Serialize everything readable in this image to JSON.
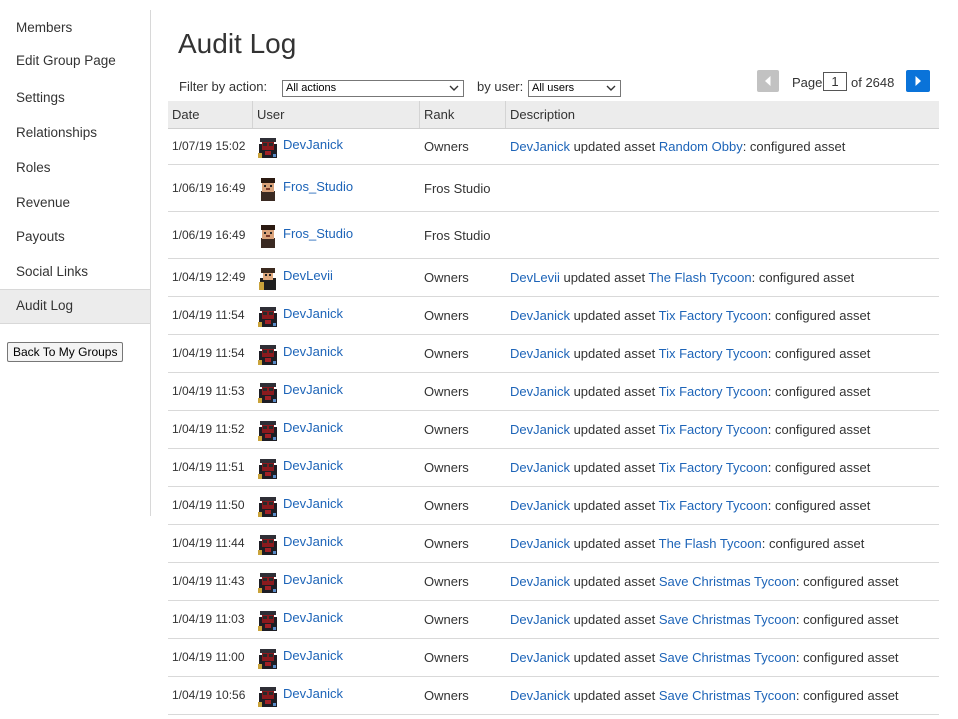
{
  "sidebar": {
    "items": [
      {
        "label": "Members"
      },
      {
        "label": "Edit Group Page"
      },
      {
        "label": "Settings"
      },
      {
        "label": "Relationships"
      },
      {
        "label": "Roles"
      },
      {
        "label": "Revenue"
      },
      {
        "label": "Payouts"
      },
      {
        "label": "Social Links"
      },
      {
        "label": "Audit Log",
        "active": true
      }
    ],
    "back_button": "Back To My Groups"
  },
  "main": {
    "title": "Audit Log",
    "filter_action_label": "Filter by action:",
    "filter_action_value": "All actions",
    "filter_user_label": "by user:",
    "filter_user_value": "All users"
  },
  "pagination": {
    "page_label": "Page",
    "current_page": "1",
    "of_label": "of 2648"
  },
  "table": {
    "headers": {
      "date": "Date",
      "user": "User",
      "rank": "Rank",
      "description": "Description"
    },
    "rows": [
      {
        "date": "1/07/19 15:02",
        "user": "DevJanick",
        "avatar": "devjanick",
        "rank": "Owners",
        "desc_user": "DevJanick",
        "desc_action": " updated asset ",
        "asset": "Random Obby",
        "desc_tail": ": configured asset"
      },
      {
        "date": "1/06/19 16:49",
        "user": "Fros_Studio",
        "avatar": "fros",
        "rank": "Fros Studio",
        "desc_user": "",
        "desc_action": "",
        "asset": "",
        "desc_tail": ""
      },
      {
        "date": "1/06/19 16:49",
        "user": "Fros_Studio",
        "avatar": "fros",
        "rank": "Fros Studio",
        "desc_user": "",
        "desc_action": "",
        "asset": "",
        "desc_tail": ""
      },
      {
        "date": "1/04/19 12:49",
        "user": "DevLevii",
        "avatar": "devlevii",
        "rank": "Owners",
        "desc_user": "DevLevii",
        "desc_action": " updated asset ",
        "asset": "The Flash Tycoon",
        "desc_tail": ": configured asset"
      },
      {
        "date": "1/04/19 11:54",
        "user": "DevJanick",
        "avatar": "devjanick",
        "rank": "Owners",
        "desc_user": "DevJanick",
        "desc_action": " updated asset ",
        "asset": "Tix Factory Tycoon",
        "desc_tail": ": configured asset"
      },
      {
        "date": "1/04/19 11:54",
        "user": "DevJanick",
        "avatar": "devjanick",
        "rank": "Owners",
        "desc_user": "DevJanick",
        "desc_action": " updated asset ",
        "asset": "Tix Factory Tycoon",
        "desc_tail": ": configured asset"
      },
      {
        "date": "1/04/19 11:53",
        "user": "DevJanick",
        "avatar": "devjanick",
        "rank": "Owners",
        "desc_user": "DevJanick",
        "desc_action": " updated asset ",
        "asset": "Tix Factory Tycoon",
        "desc_tail": ": configured asset"
      },
      {
        "date": "1/04/19 11:52",
        "user": "DevJanick",
        "avatar": "devjanick",
        "rank": "Owners",
        "desc_user": "DevJanick",
        "desc_action": " updated asset ",
        "asset": "Tix Factory Tycoon",
        "desc_tail": ": configured asset"
      },
      {
        "date": "1/04/19 11:51",
        "user": "DevJanick",
        "avatar": "devjanick",
        "rank": "Owners",
        "desc_user": "DevJanick",
        "desc_action": " updated asset ",
        "asset": "Tix Factory Tycoon",
        "desc_tail": ": configured asset"
      },
      {
        "date": "1/04/19 11:50",
        "user": "DevJanick",
        "avatar": "devjanick",
        "rank": "Owners",
        "desc_user": "DevJanick",
        "desc_action": " updated asset ",
        "asset": "Tix Factory Tycoon",
        "desc_tail": ": configured asset"
      },
      {
        "date": "1/04/19 11:44",
        "user": "DevJanick",
        "avatar": "devjanick",
        "rank": "Owners",
        "desc_user": "DevJanick",
        "desc_action": " updated asset ",
        "asset": "The Flash Tycoon",
        "desc_tail": ": configured asset"
      },
      {
        "date": "1/04/19 11:43",
        "user": "DevJanick",
        "avatar": "devjanick",
        "rank": "Owners",
        "desc_user": "DevJanick",
        "desc_action": " updated asset ",
        "asset": "Save Christmas Tycoon",
        "desc_tail": ": configured asset"
      },
      {
        "date": "1/04/19 11:03",
        "user": "DevJanick",
        "avatar": "devjanick",
        "rank": "Owners",
        "desc_user": "DevJanick",
        "desc_action": " updated asset ",
        "asset": "Save Christmas Tycoon",
        "desc_tail": ": configured asset"
      },
      {
        "date": "1/04/19 11:00",
        "user": "DevJanick",
        "avatar": "devjanick",
        "rank": "Owners",
        "desc_user": "DevJanick",
        "desc_action": " updated asset ",
        "asset": "Save Christmas Tycoon",
        "desc_tail": ": configured asset"
      },
      {
        "date": "1/04/19 10:56",
        "user": "DevJanick",
        "avatar": "devjanick",
        "rank": "Owners",
        "desc_user": "DevJanick",
        "desc_action": " updated asset ",
        "asset": "Save Christmas Tycoon",
        "desc_tail": ": configured asset"
      }
    ]
  },
  "colors": {
    "link": "#1d64b8",
    "next_button": "#0a73d9",
    "prev_button": "#c2c2c2",
    "header_bg": "#ececec"
  }
}
